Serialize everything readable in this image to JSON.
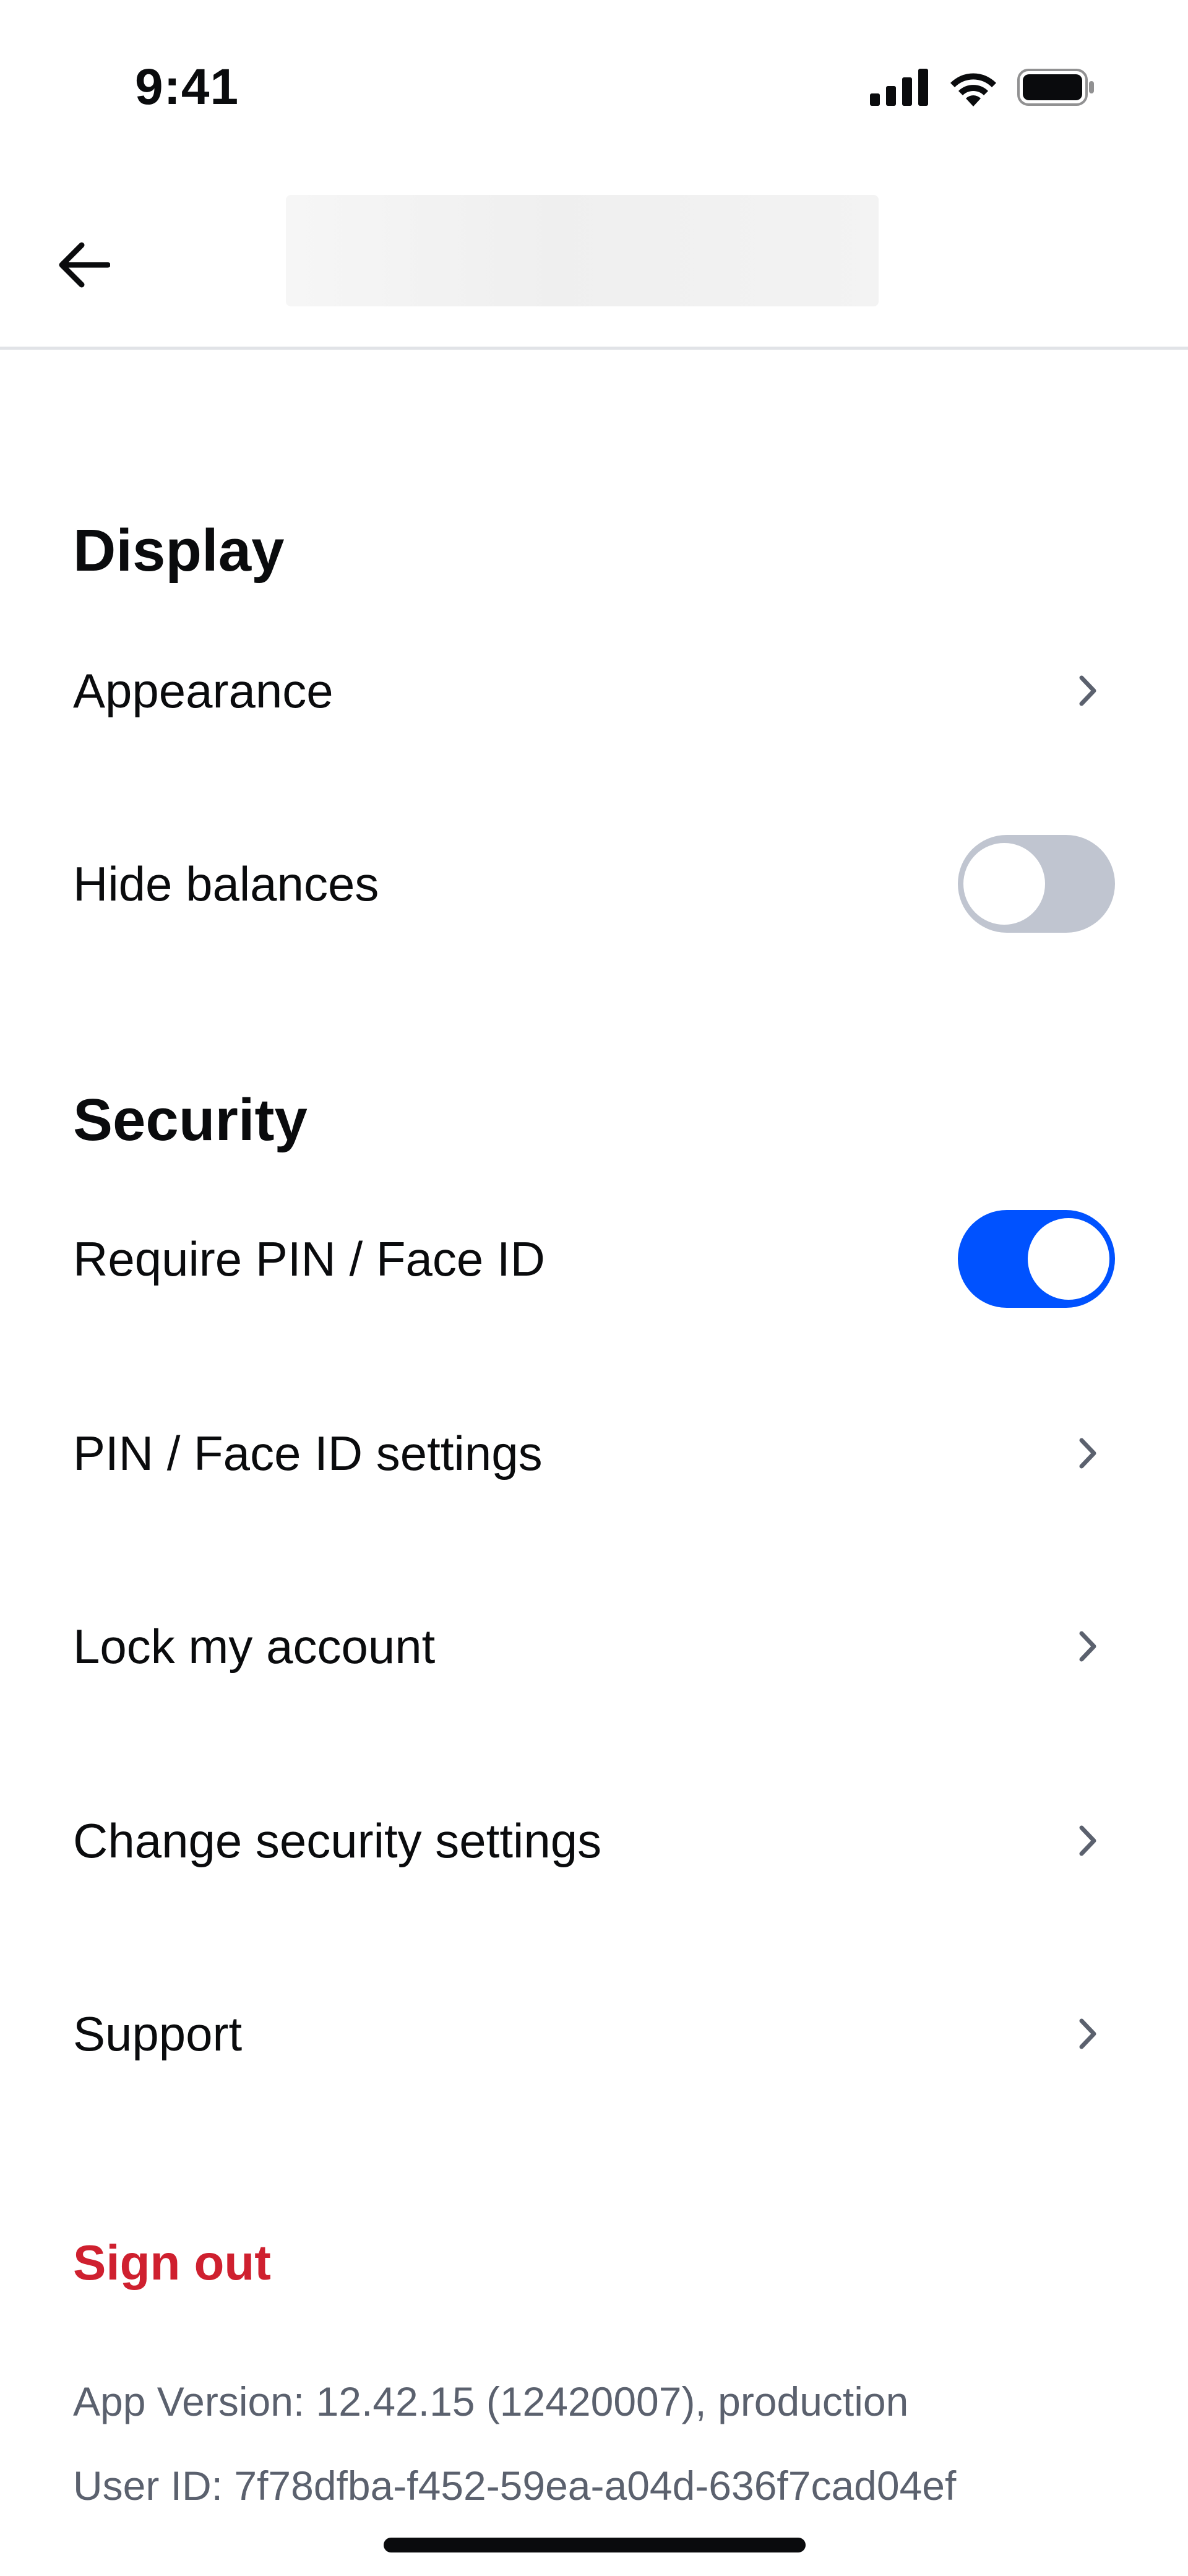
{
  "status_bar": {
    "time": "9:41",
    "icons": [
      "signal-icon",
      "wifi-icon",
      "battery-icon"
    ]
  },
  "nav": {
    "back_icon": "arrow-left-icon"
  },
  "display_section": {
    "heading": "Display",
    "appearance_label": "Appearance",
    "hide_balances_label": "Hide balances",
    "hide_balances_enabled": false
  },
  "security_section": {
    "heading": "Security",
    "require_pin_label": "Require PIN / Face ID",
    "require_pin_enabled": true,
    "pin_settings_label": "PIN / Face ID settings",
    "lock_account_label": "Lock my account",
    "change_security_label": "Change security settings"
  },
  "support_label": "Support",
  "sign_out_label": "Sign out",
  "app_version": "App Version: 12.42.15 (12420007), production",
  "user_id": "User ID: 7f78dfba-f452-59ea-a04d-636f7cad04ef",
  "colors": {
    "accent": "#0052ff",
    "toggle_off": "#c0c5d0",
    "danger": "#cf202f",
    "muted_text": "#5b616e"
  }
}
